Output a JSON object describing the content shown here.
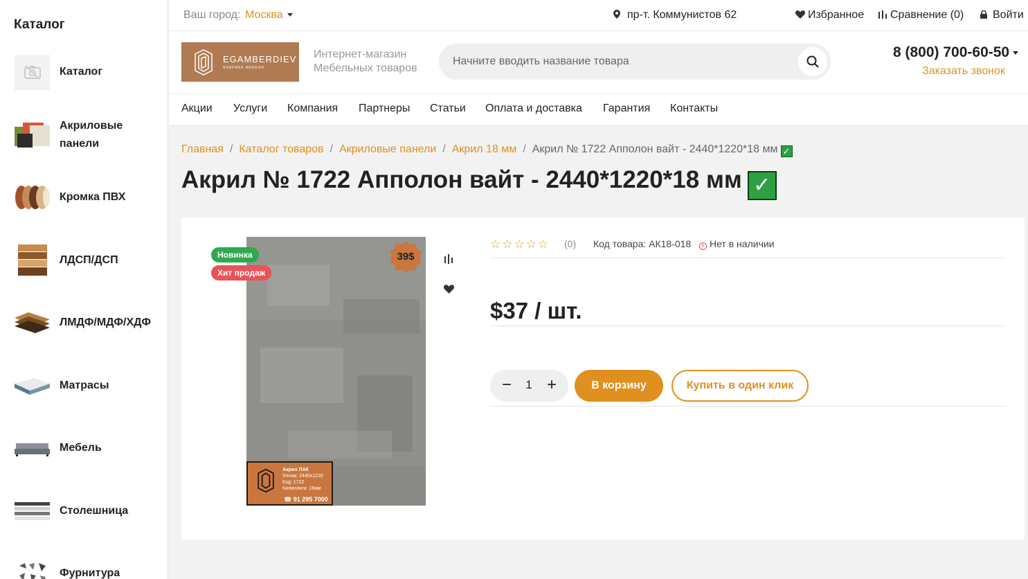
{
  "sidebar": {
    "title": "Каталог",
    "items": [
      {
        "label": "Каталог",
        "icon": "no-image-icon"
      },
      {
        "label": "Акриловые панели",
        "icon": "acrylic-panels-thumb"
      },
      {
        "label": "Кромка ПВХ",
        "icon": "pvc-edge-thumb"
      },
      {
        "label": "ЛДСП/ДСП",
        "icon": "chipboard-thumb"
      },
      {
        "label": "ЛМДФ/МДФ/ХДФ",
        "icon": "mdf-thumb"
      },
      {
        "label": "Матрасы",
        "icon": "mattress-thumb"
      },
      {
        "label": "Мебель",
        "icon": "furniture-thumb"
      },
      {
        "label": "Столешница",
        "icon": "countertop-thumb"
      },
      {
        "label": "Фурнитура",
        "icon": "hardware-thumb"
      }
    ]
  },
  "topbar": {
    "city_label": "Ваш город:",
    "city": "Москва",
    "address": "пр-т. Коммунистов 62",
    "favorites": "Избранное",
    "compare": "Сравнение (0)",
    "login": "Войти"
  },
  "header": {
    "logo_text": "EGAMBERDIEV",
    "logo_sub": "ФАБРИКА МЕБЕЛИ",
    "tagline_1": "Интернет-магазин",
    "tagline_2": "Мебельных товаров",
    "search_placeholder": "Начните вводить название товара",
    "phone": "8 (800) 700-60-50",
    "callback": "Заказать звонок"
  },
  "nav": [
    "Акции",
    "Услуги",
    "Компания",
    "Партнеры",
    "Статьи",
    "Оплата и доставка",
    "Гарантия",
    "Контакты"
  ],
  "breadcrumbs": {
    "links": [
      "Главная",
      "Каталог товаров",
      "Акриловые панели",
      "Акрил 18 мм"
    ],
    "separator": "/",
    "current": "Акрил № 1722 Апполон вайт - 2440*1220*18 мм"
  },
  "product": {
    "title": "Акрил № 1722 Апполон вайт - 2440*1220*18 мм",
    "badges": [
      "Новинка",
      "Хит продаж"
    ],
    "sticker_price": "39$",
    "label_lines": [
      "Акрил ЛАК",
      "Улчам:    2440x1220",
      "Код:          1722",
      "Калинлиги:   18мм"
    ],
    "label_phone": "91 295 7000",
    "rating_count": "(0)",
    "sku": "Код товара: АК18-018",
    "stock": "Нет в наличии",
    "price": "$37 / шт.",
    "quantity": "1",
    "add_to_cart": "В корзину",
    "one_click": "Купить в один клик"
  },
  "colors": {
    "accent": "#e0901f",
    "badge_new": "#2fa94f",
    "badge_hit": "#e9525a",
    "check": "#2ea043"
  }
}
